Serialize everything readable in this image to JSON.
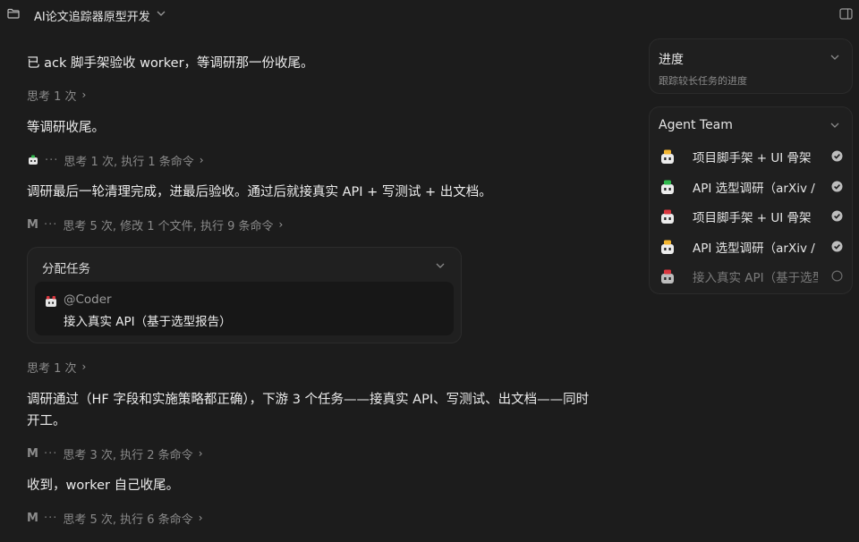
{
  "titlebar": {
    "title": "AI论文追踪器原型开发",
    "icons": [
      "folder-icon",
      "chevron-down-icon",
      "panel-toggle-icon"
    ]
  },
  "chat": {
    "msg1": "已 ack 脚手架验收 worker，等调研那一份收尾。",
    "meta1": "思考 1 次",
    "msg2": "等调研收尾。",
    "meta2": "思考 1 次, 执行 1 条命令",
    "msg3": "调研最后一轮清理完成，进最后验收。通过后就接真实 API + 写测试 + 出文档。",
    "meta3_avatar": "M",
    "meta3": "思考 5 次, 修改 1 个文件, 执行 9 条命令",
    "task_card": {
      "title": "分配任务",
      "assignee": "@Coder",
      "task": "接入真实 API（基于选型报告）"
    },
    "meta4": "思考 1 次",
    "msg4_line1": "调研通过（HF 字段和实施策略都正确），下游 3 个任务——接真实 API、写测试、出文档——同时",
    "msg4_line2": "开工。",
    "meta5_avatar": "M",
    "meta5": "思考 3 次, 执行 2 条命令",
    "msg5": "收到，worker 自己收尾。",
    "meta6_avatar": "M",
    "meta6": "思考 5 次, 执行 6 条命令",
    "dots": "···",
    "chevron": "›"
  },
  "progress": {
    "title": "进度",
    "subtitle": "跟踪较长任务的进度"
  },
  "team": {
    "title": "Agent Team",
    "members": [
      {
        "label": "项目脚手架 + UI 骨架",
        "status": "done",
        "accent": "#f2b531"
      },
      {
        "label": "API 选型调研（arXiv / HF）",
        "status": "done",
        "accent": "#2fb84c"
      },
      {
        "label": "项目脚手架 + UI 骨架",
        "status": "done",
        "accent": "#d9363e"
      },
      {
        "label": "API 选型调研（arXiv / HF）",
        "status": "done",
        "accent": "#f2b531"
      },
      {
        "label": "接入真实 API（基于选型报告）",
        "status": "pending",
        "accent": "#d9363e"
      }
    ]
  },
  "colors": {
    "background": "#1c1c1c",
    "card": "#1f1f1f",
    "text": "#ececec",
    "muted": "#8a8a8a"
  }
}
